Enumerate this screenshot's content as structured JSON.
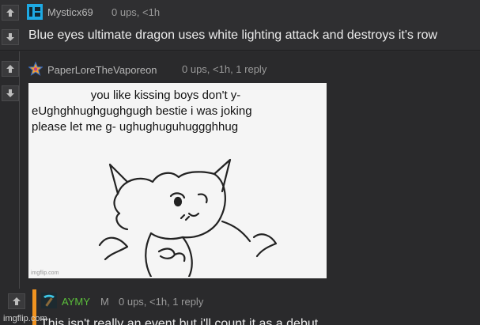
{
  "comments": [
    {
      "username": "Mysticx69",
      "meta": "0 ups, <1h",
      "body": "Blue eyes ultimate dragon uses white lighting attack and destroys it's row",
      "avatar_icon": "blue-square-face-icon",
      "avatar_color": "#1ea9e3"
    },
    {
      "username": "PaperLoreTheVaporeon",
      "meta": "0 ups, <1h, 1 reply",
      "avatar_icon": "rainbow-star-icon",
      "image": {
        "caption_lines": [
          "you like kissing boys don't y-",
          "eUghghhughgughgugh bestie i was joking",
          "please let me g- ughughuguhuggghhug"
        ],
        "watermark": "imgflip.com"
      }
    },
    {
      "username": "AYMY",
      "badge": "M",
      "meta": "0 ups, <1h, 1 reply",
      "body": "This isn't really an event but i'll count it as a debut",
      "avatar_icon": "pickaxe-icon",
      "username_color": "#5bbf3b",
      "op_color": "#f19320"
    }
  ],
  "watermark": "imgflip.com",
  "icons": {
    "upvote": "arrow-up-icon",
    "downvote": "arrow-down-icon"
  }
}
